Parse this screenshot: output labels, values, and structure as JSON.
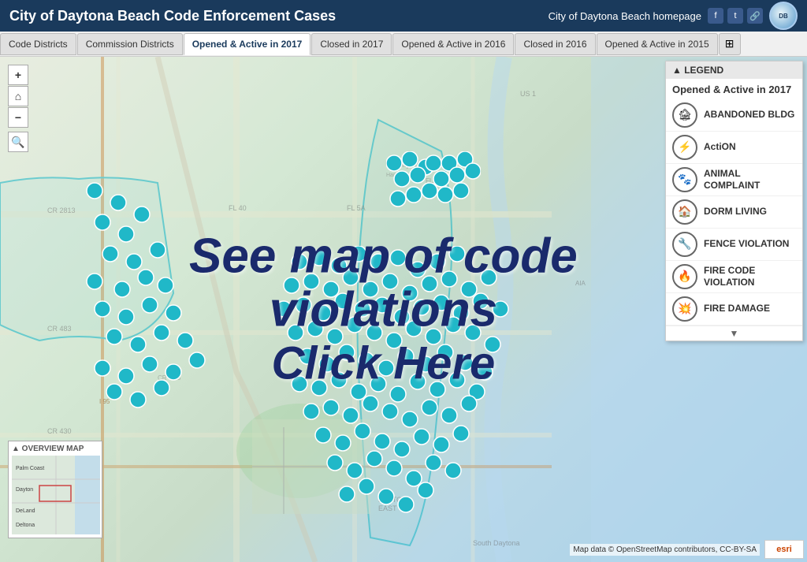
{
  "header": {
    "title": "City of Daytona Beach Code Enforcement Cases",
    "homepage_link": "City of Daytona Beach homepage",
    "social": {
      "facebook": "f",
      "twitter": "t",
      "link": "🔗"
    }
  },
  "nav": {
    "tabs": [
      {
        "id": "code-districts",
        "label": "Code Districts",
        "active": false
      },
      {
        "id": "commission-districts",
        "label": "Commission Districts",
        "active": false
      },
      {
        "id": "opened-active-2017",
        "label": "Opened & Active in 2017",
        "active": true
      },
      {
        "id": "closed-2017",
        "label": "Closed in 2017",
        "active": false
      },
      {
        "id": "opened-active-2016",
        "label": "Opened & Active in 2016",
        "active": false
      },
      {
        "id": "closed-2016",
        "label": "Closed in 2016",
        "active": false
      },
      {
        "id": "opened-active-2015",
        "label": "Opened & Active in 2015",
        "active": false
      }
    ],
    "table_icon": "⊞"
  },
  "map": {
    "overlay_line1": "See map of code violations",
    "overlay_line2": "Click Here",
    "attribution": "Map data © OpenStreetMap contributors, CC-BY-SA",
    "esri_label": "esri"
  },
  "map_controls": {
    "zoom_in": "+",
    "home": "⌂",
    "zoom_out": "−",
    "search": "🔍"
  },
  "overview_map": {
    "label": "▲ OVERVIEW MAP",
    "cities": [
      "Palm Coast",
      "Dayton",
      "DeLand",
      "Deltona"
    ]
  },
  "legend": {
    "header": "▲ LEGEND",
    "title": "Opened & Active in 2017",
    "scroll_indicator": "▼",
    "items": [
      {
        "id": "abandoned-bldg",
        "label": "ABANDONED BLDG",
        "icon": "🏚"
      },
      {
        "id": "action",
        "label": "ACTION",
        "icon": "⚡"
      },
      {
        "id": "animal-complaint",
        "label": "ANIMAL COMPLAINT",
        "icon": "🐾"
      },
      {
        "id": "dorm-living",
        "label": "DORM LIVING",
        "icon": "🏠"
      },
      {
        "id": "fence-violation",
        "label": "FENCE VIOLATION",
        "icon": "🔧"
      },
      {
        "id": "fire-code-violation",
        "label": "FIRE CODE VIOLATION",
        "icon": "🔥"
      },
      {
        "id": "fire-damage",
        "label": "FIRE DAMAGE",
        "icon": "💥"
      }
    ]
  }
}
